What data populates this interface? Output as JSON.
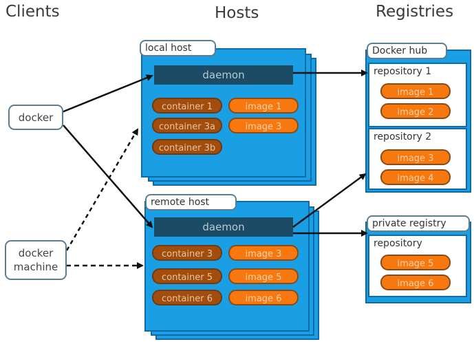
{
  "columns": {
    "clients": "Clients",
    "hosts": "Hosts",
    "registries": "Registries"
  },
  "clients": [
    {
      "label": "docker"
    },
    {
      "label": "docker machine"
    }
  ],
  "hosts": [
    {
      "label": "local host",
      "daemon": "daemon",
      "containers": [
        "container 1",
        "container 3a",
        "container 3b"
      ],
      "images": [
        "image 1",
        "image 3"
      ]
    },
    {
      "label": "remote host",
      "daemon": "daemon",
      "containers": [
        "container 3",
        "container 5",
        "container 6"
      ],
      "images": [
        "image 3",
        "image 5",
        "image 6"
      ]
    }
  ],
  "registries": [
    {
      "label": "Docker hub",
      "repositories": [
        {
          "label": "repository 1",
          "images": [
            "image 1",
            "image 2"
          ]
        },
        {
          "label": "repository 2",
          "images": [
            "image 3",
            "image 4"
          ]
        }
      ]
    },
    {
      "label": "private registry",
      "repositories": [
        {
          "label": "repository",
          "images": [
            "image 5",
            "image 6"
          ]
        }
      ]
    }
  ],
  "connections": [
    {
      "from": "docker",
      "to": "local host daemon",
      "style": "solid"
    },
    {
      "from": "docker",
      "to": "remote host daemon",
      "style": "solid"
    },
    {
      "from": "docker machine",
      "to": "local host",
      "style": "dashed"
    },
    {
      "from": "docker machine",
      "to": "remote host",
      "style": "dashed"
    },
    {
      "from": "local host daemon",
      "to": "repository 1",
      "style": "solid"
    },
    {
      "from": "remote host daemon",
      "to": "repository 2",
      "style": "solid"
    },
    {
      "from": "remote host daemon",
      "to": "private registry",
      "style": "solid"
    }
  ],
  "colors": {
    "host_blue": "#1a9fe4",
    "daemon": "#1c4b66",
    "container": "#a24d0c",
    "image": "#f6780f"
  }
}
